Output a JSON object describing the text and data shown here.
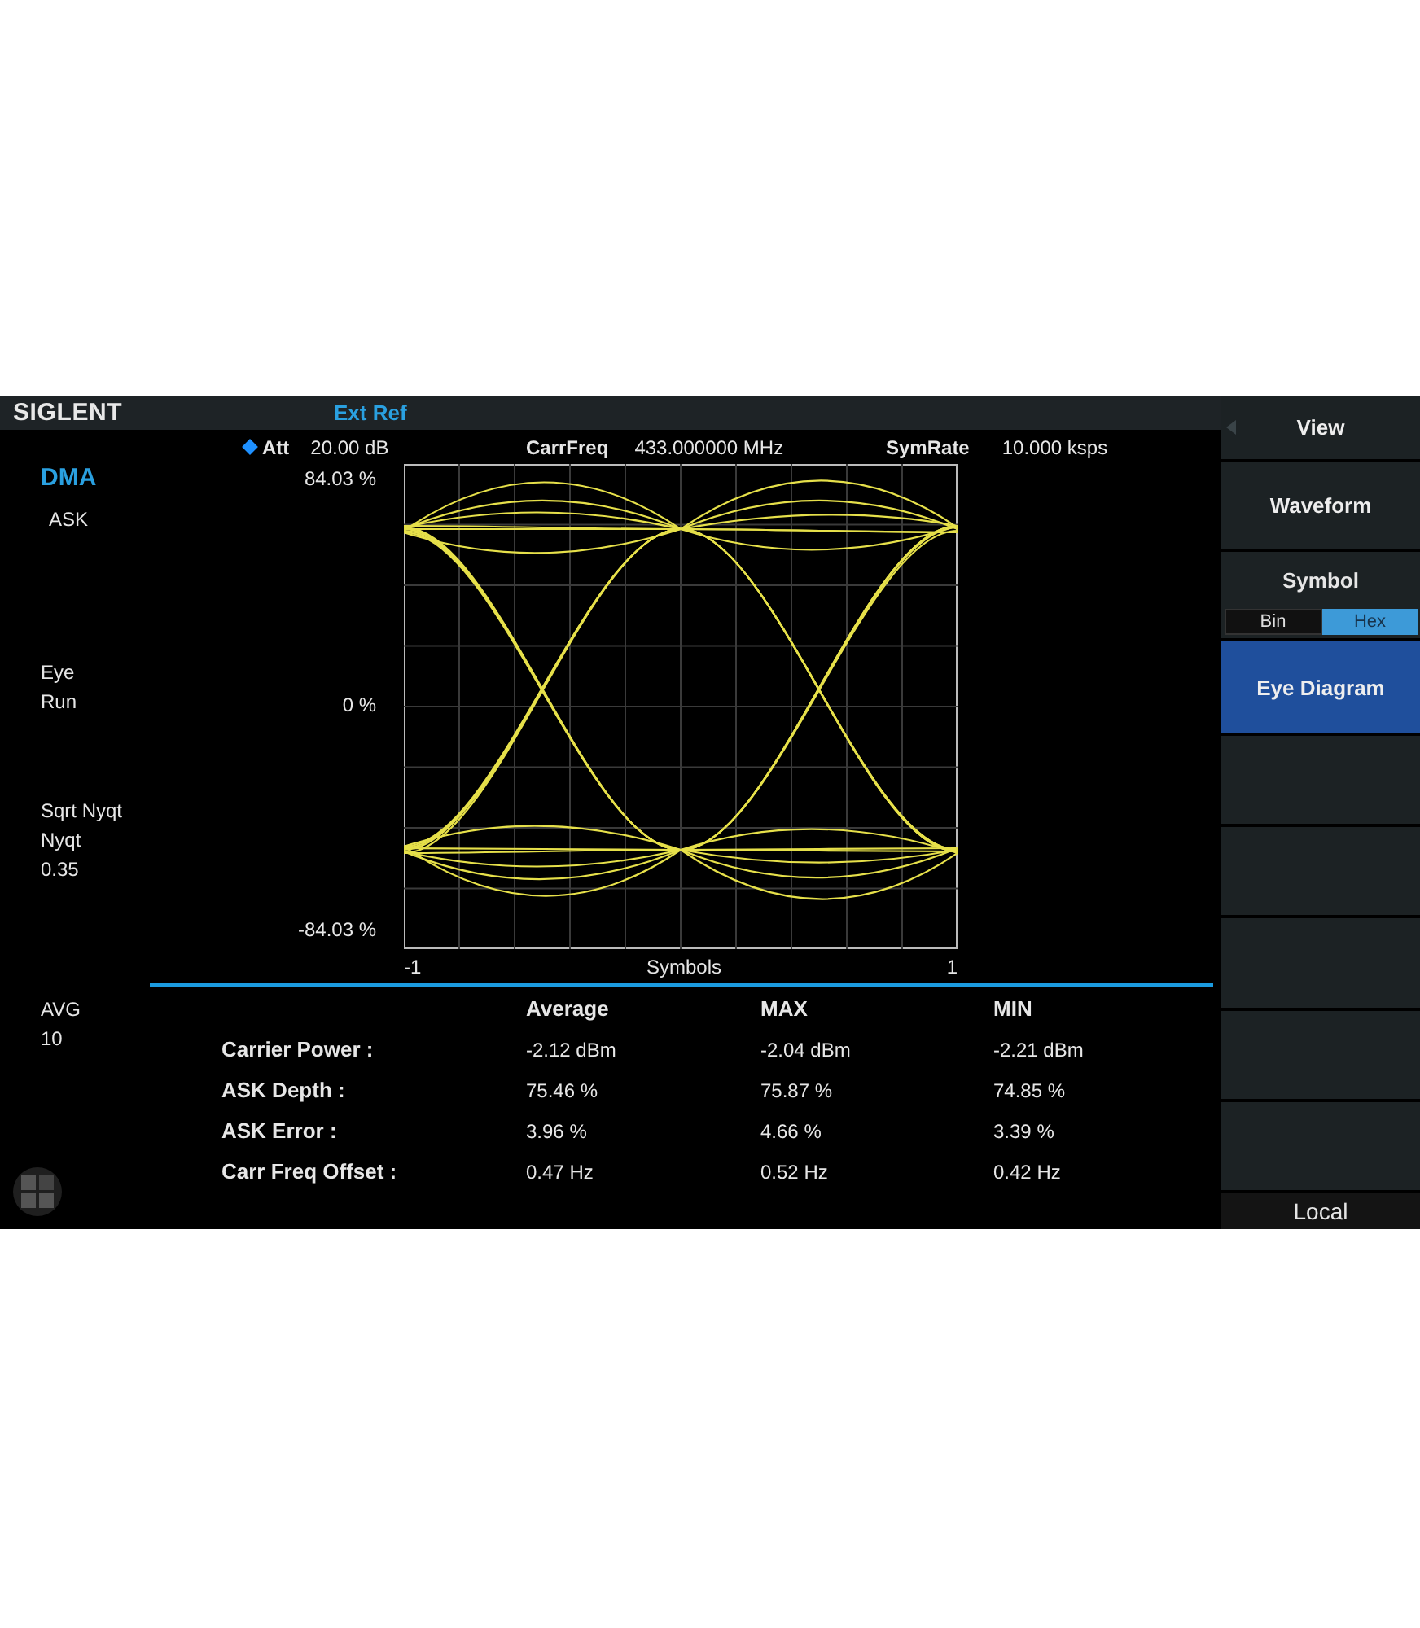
{
  "header": {
    "logo": "SIGLENT",
    "reference": "Ext Ref"
  },
  "status": {
    "mode": "DMA",
    "modulation": "ASK",
    "display": "Eye",
    "state": "Run",
    "filter": "Sqrt Nyqt",
    "filter_type": "Nyqt",
    "alpha": "0.35",
    "avg_label": "AVG",
    "avg_count": "10"
  },
  "info": [
    {
      "label": "Att",
      "value": "20.00 dB",
      "marker": true
    },
    {
      "label": "CarrFreq",
      "value": "433.000000 MHz",
      "marker": false
    },
    {
      "label": "SymRate",
      "value": "10.000 ksps",
      "marker": false
    }
  ],
  "eye_diagram": {
    "y_labels": [
      "84.03 %",
      "0 %",
      "-84.03 %"
    ],
    "x_labels": [
      "-1",
      "Symbols",
      "1"
    ]
  },
  "table": {
    "columns": [
      "Average",
      "MAX",
      "MIN"
    ],
    "rows": [
      {
        "label": "Carrier Power :",
        "values": [
          "-2.12 dBm",
          "-2.04 dBm",
          "-2.21 dBm"
        ]
      },
      {
        "label": "ASK Depth :",
        "values": [
          "75.46 %",
          "75.87 %",
          "74.85 %"
        ]
      },
      {
        "label": "ASK Error :",
        "values": [
          "3.96 %",
          "4.66 %",
          "3.39 %"
        ]
      },
      {
        "label": "Carr Freq Offset :",
        "values": [
          "0.47 Hz",
          "0.52 Hz",
          "0.42 Hz"
        ]
      }
    ]
  },
  "softkeys": [
    {
      "kind": "title",
      "label": "View",
      "selected": false
    },
    {
      "kind": "button",
      "label": "Waveform",
      "selected": false
    },
    {
      "kind": "toggle",
      "label": "Symbol",
      "selected": false,
      "options": [
        {
          "label": "Bin",
          "selected": false
        },
        {
          "label": "Hex",
          "selected": true
        }
      ]
    },
    {
      "kind": "button",
      "label": "Eye Diagram",
      "selected": true
    },
    {
      "kind": "empty",
      "selected": false
    },
    {
      "kind": "empty",
      "selected": false
    },
    {
      "kind": "empty",
      "selected": false
    },
    {
      "kind": "empty",
      "selected": false
    },
    {
      "kind": "empty",
      "selected": false
    }
  ],
  "footer": {
    "remote": "Local"
  }
}
